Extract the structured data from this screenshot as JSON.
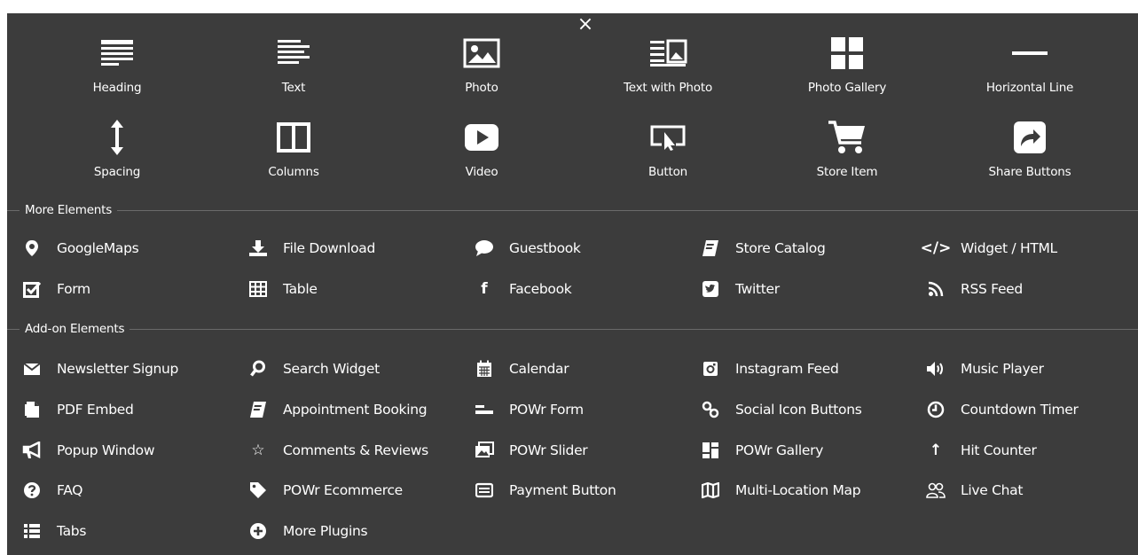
{
  "close_label": "×",
  "basic_elements": [
    {
      "label": "Heading",
      "icon": "heading-icon"
    },
    {
      "label": "Text",
      "icon": "text-icon"
    },
    {
      "label": "Photo",
      "icon": "photo-icon"
    },
    {
      "label": "Text with Photo",
      "icon": "text-with-photo-icon"
    },
    {
      "label": "Photo Gallery",
      "icon": "photo-gallery-icon"
    },
    {
      "label": "Horizontal Line",
      "icon": "horizontal-line-icon"
    },
    {
      "label": "Spacing",
      "icon": "spacing-icon"
    },
    {
      "label": "Columns",
      "icon": "columns-icon"
    },
    {
      "label": "Video",
      "icon": "video-icon"
    },
    {
      "label": "Button",
      "icon": "button-icon"
    },
    {
      "label": "Store Item",
      "icon": "cart-icon"
    },
    {
      "label": "Share Buttons",
      "icon": "share-icon"
    }
  ],
  "more_elements": {
    "title": "More Elements",
    "items": [
      {
        "label": "GoogleMaps",
        "icon": "map-pin-icon",
        "glyph": ""
      },
      {
        "label": "File Download",
        "icon": "download-icon",
        "glyph": ""
      },
      {
        "label": "Guestbook",
        "icon": "comment-icon",
        "glyph": ""
      },
      {
        "label": "Store Catalog",
        "icon": "catalog-icon",
        "glyph": ""
      },
      {
        "label": "Widget / HTML",
        "icon": "code-icon",
        "glyph": "</>"
      },
      {
        "label": "Form",
        "icon": "checkbox-icon",
        "glyph": ""
      },
      {
        "label": "Table",
        "icon": "table-icon",
        "glyph": ""
      },
      {
        "label": "Facebook",
        "icon": "facebook-icon",
        "glyph": "f"
      },
      {
        "label": "Twitter",
        "icon": "twitter-icon",
        "glyph": ""
      },
      {
        "label": "RSS Feed",
        "icon": "rss-icon",
        "glyph": ""
      }
    ]
  },
  "addon_elements": {
    "title": "Add-on Elements",
    "items": [
      {
        "label": "Newsletter Signup",
        "icon": "envelope-icon",
        "glyph": ""
      },
      {
        "label": "Search Widget",
        "icon": "search-icon",
        "glyph": ""
      },
      {
        "label": "Calendar",
        "icon": "calendar-icon",
        "glyph": ""
      },
      {
        "label": "Instagram Feed",
        "icon": "instagram-icon",
        "glyph": ""
      },
      {
        "label": "Music Player",
        "icon": "speaker-icon",
        "glyph": ""
      },
      {
        "label": "PDF Embed",
        "icon": "pdf-icon",
        "glyph": ""
      },
      {
        "label": "Appointment Booking",
        "icon": "book-icon",
        "glyph": ""
      },
      {
        "label": "POWr Form",
        "icon": "form-lines-icon",
        "glyph": ""
      },
      {
        "label": "Social Icon Buttons",
        "icon": "link-icon",
        "glyph": ""
      },
      {
        "label": "Countdown Timer",
        "icon": "clock-icon",
        "glyph": ""
      },
      {
        "label": "Popup Window",
        "icon": "megaphone-icon",
        "glyph": ""
      },
      {
        "label": "Comments & Reviews",
        "icon": "star-icon",
        "glyph": "☆"
      },
      {
        "label": "POWr Slider",
        "icon": "slider-icon",
        "glyph": ""
      },
      {
        "label": "POWr Gallery",
        "icon": "gallery-grid-icon",
        "glyph": ""
      },
      {
        "label": "Hit Counter",
        "icon": "arrow-up-icon",
        "glyph": "↑"
      },
      {
        "label": "FAQ",
        "icon": "question-icon",
        "glyph": "?"
      },
      {
        "label": "POWr Ecommerce",
        "icon": "tag-icon",
        "glyph": ""
      },
      {
        "label": "Payment Button",
        "icon": "payment-icon",
        "glyph": ""
      },
      {
        "label": "Multi-Location Map",
        "icon": "map-icon",
        "glyph": ""
      },
      {
        "label": "Live Chat",
        "icon": "users-icon",
        "glyph": ""
      },
      {
        "label": "Tabs",
        "icon": "list-icon",
        "glyph": ""
      },
      {
        "label": "More Plugins",
        "icon": "plus-circle-icon",
        "glyph": ""
      }
    ]
  },
  "colors": {
    "panel_bg": "#3c3c3c",
    "text": "#ffffff",
    "divider": "#6a6a6a"
  }
}
